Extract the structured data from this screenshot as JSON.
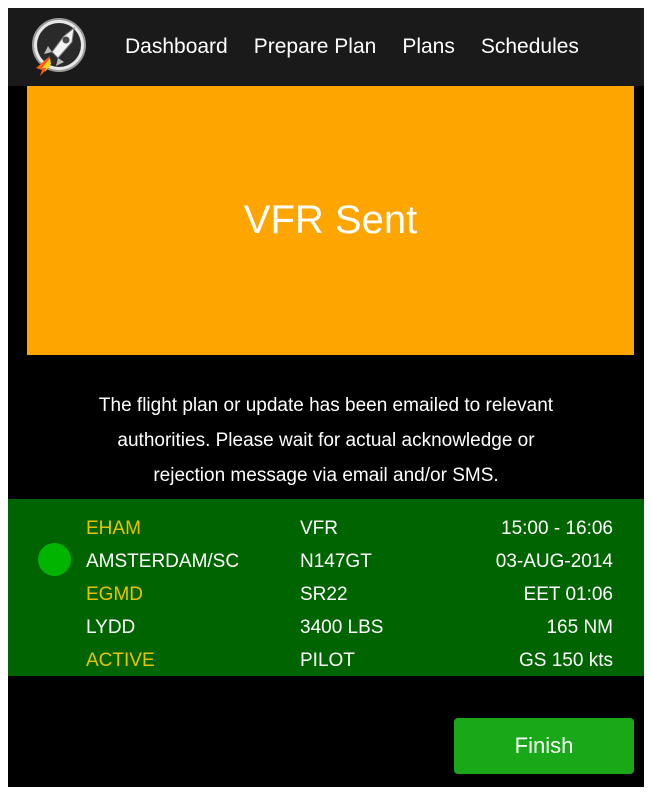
{
  "navbar": {
    "items": [
      {
        "label": "Dashboard"
      },
      {
        "label": "Prepare Plan"
      },
      {
        "label": "Plans"
      },
      {
        "label": "Schedules"
      }
    ]
  },
  "status": {
    "title": "VFR Sent",
    "color": "#ffa500"
  },
  "message": {
    "line1": "The flight plan or update has been emailed to relevant",
    "line2": "authorities. Please wait for actual acknowledge or",
    "line3": "rejection message via email and/or SMS."
  },
  "plan": {
    "departure_code": "EHAM",
    "departure_name": "AMSTERDAM/SC",
    "destination_code": "EGMD",
    "destination_name": "LYDD",
    "state": "ACTIVE",
    "flight_rules": "VFR",
    "registration": "N147GT",
    "aircraft_type": "SR22",
    "weight": "3400 LBS",
    "role": "PILOT",
    "time_window": "15:00 - 16:06",
    "date": "03-AUG-2014",
    "eet": "EET 01:06",
    "distance": "165 NM",
    "ground_speed": "GS 150 kts",
    "card_color": "#006400",
    "indicator_color": "#00b400"
  },
  "actions": {
    "finish_label": "Finish",
    "finish_color": "#18a818"
  }
}
